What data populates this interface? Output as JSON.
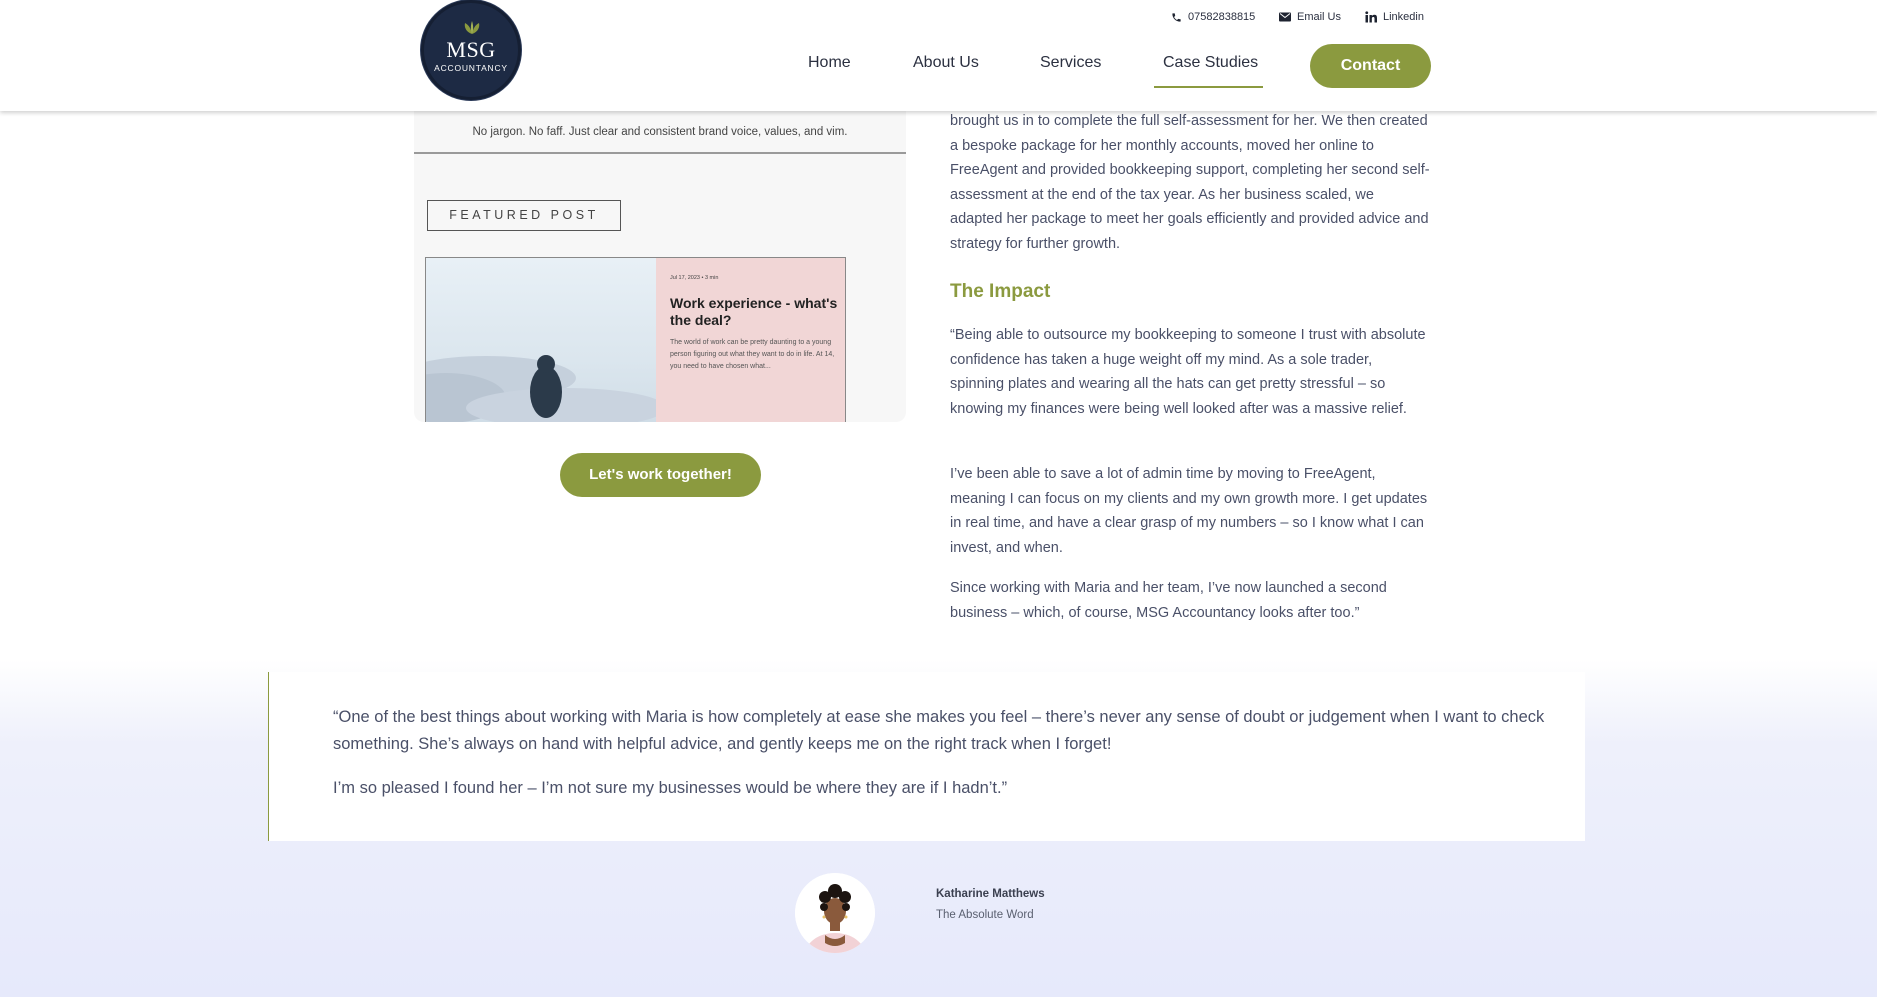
{
  "header": {
    "logo": {
      "name": "MSG",
      "sub": "ACCOUNTANCY"
    },
    "topbar": {
      "phone": "07582838815",
      "email": "Email Us",
      "linkedin": "Linkedin"
    },
    "nav": {
      "home": "Home",
      "about": "About Us",
      "services": "Services",
      "case_studies": "Case Studies",
      "contact": "Contact"
    },
    "active_nav": "Case Studies"
  },
  "screenshot": {
    "tagline": "No jargon. No faff. Just clear and consistent brand voice, values, and vim.",
    "featured_label": "FEATURED POST",
    "post": {
      "meta": "Jul 17, 2023 • 3 min",
      "title": "Work experience - what's the deal?",
      "excerpt": "The world of work can be pretty daunting to a young person figuring out what they want to do in life. At 14, you need to have chosen what..."
    }
  },
  "cta": {
    "label": "Let's work together!"
  },
  "content": {
    "intro": "brought us in to complete the full self-assessment for her. We then created a bespoke package for her monthly accounts, moved her online to FreeAgent and provided bookkeeping support, completing her second self-assessment at the end of the tax year. As her business scaled, we adapted her package to meet her goals efficiently and provided advice and strategy for further growth.",
    "impact_title": "The Impact",
    "p1": "“Being able to outsource my bookkeeping to someone I trust with absolute confidence has taken a huge weight off my mind. As a sole trader, spinning plates and wearing all the hats can get pretty stressful – so knowing my finances were being well looked after was a massive relief.",
    "p2": "I’ve been able to save a lot of admin time by moving to FreeAgent, meaning I can focus on my clients and my own growth more. I get updates in real time, and have a clear grasp of my numbers – so I know what I can invest, and when.",
    "p3": "Since working with Maria and her team, I’ve now launched a second business – which, of course, MSG Accountancy looks after too.”"
  },
  "testimonial": {
    "quote1": "“One of the best things about working with Maria is how completely at ease she makes you feel – there’s never any sense of doubt or judgement when I want to check something. She’s always on hand with helpful advice, and gently keeps me on the right track when I forget!",
    "quote2": "I’m so pleased I found her – I’m not sure my businesses would be where they are if I hadn’t.”",
    "author": "Katharine Matthews",
    "company": "The Absolute Word"
  },
  "colors": {
    "accent": "#8b9a3f",
    "navy": "#1d2a44",
    "text": "#4a5068",
    "bottom_bg": "#e6e9fb"
  },
  "icons": {
    "phone": "phone-icon",
    "email": "mail-icon",
    "linkedin": "linkedin-icon"
  }
}
